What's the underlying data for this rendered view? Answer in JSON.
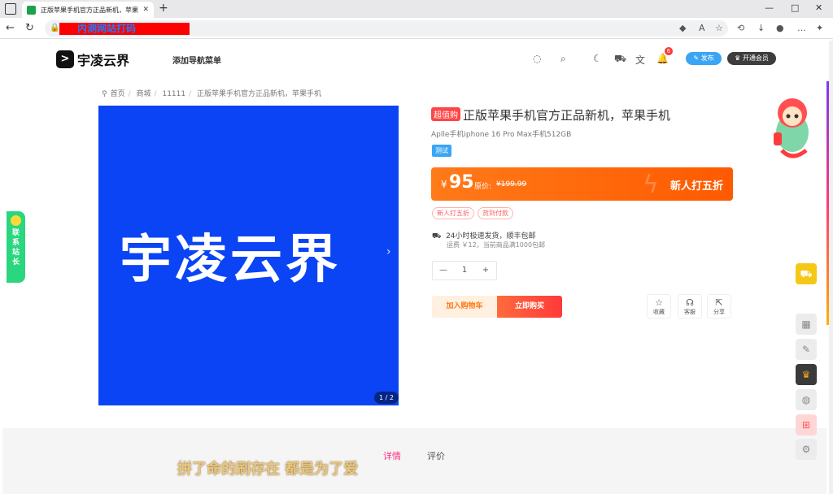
{
  "browser": {
    "tab_title": "正版苹果手机官方正品新机，苹果",
    "tab_close": "✕",
    "new_tab": "+",
    "address_text": "内测网站打码",
    "controls": {
      "minimize": "—",
      "maximize": "□",
      "close": "✕"
    }
  },
  "site": {
    "logo_text": "宇凌云界",
    "nav_menu": "添加导航菜单",
    "notification_count": "6",
    "publish_label": "发布",
    "vip_label": "开通会员"
  },
  "breadcrumb": [
    "首页",
    "商城",
    "11111",
    "正版苹果手机官方正品新机，苹果手机"
  ],
  "gallery": {
    "image_text": "宇凌云界",
    "counter": "1 / 2"
  },
  "product": {
    "tag": "超值购",
    "title": "正版苹果手机官方正品新机，苹果手机",
    "subtitle": "Aplle手机iphone 16 Pro Max手机512GB",
    "test_badge": "测试",
    "currency": "¥",
    "price": "95",
    "orig_label": "原价:",
    "orig_price": "¥199.99",
    "promo": "新人打五折",
    "chips": [
      "新人打五折",
      "货到付款"
    ],
    "shipping": "24小时极速发货，顺丰包邮",
    "shipping_sub": "运费 ￥12，当前商品满1000包邮",
    "quantity": "1",
    "minus": "—",
    "plus": "+",
    "add_cart": "加入购物车",
    "buy_now": "立即购买",
    "actions": [
      "收藏",
      "客服",
      "分享"
    ]
  },
  "detail_tabs": [
    "详情",
    "评价"
  ],
  "subtitle_overlay": "拼了命的刷存在 都是为了爱",
  "contact": "联系站长",
  "colors": {
    "accent": "#ff7a19",
    "brand_blue": "#0a44f4",
    "publish": "#3aa5f5",
    "contact": "#2ad77f"
  }
}
